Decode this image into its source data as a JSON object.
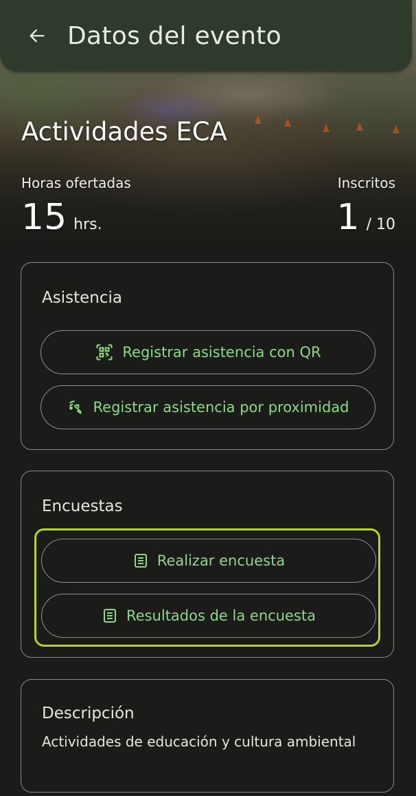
{
  "app_bar": {
    "title": "Datos del evento",
    "back_icon": "arrow-left-icon"
  },
  "event": {
    "title": "Actividades ECA",
    "hours_label": "Horas ofertadas",
    "hours_value": "15",
    "hours_unit": "hrs.",
    "enrolled_label": "Inscritos",
    "enrolled_value": "1",
    "enrolled_capacity": "/ 10"
  },
  "attendance": {
    "title": "Asistencia",
    "qr_button": "Registrar asistencia con QR",
    "qr_icon": "qr-code-scan-icon",
    "proximity_button": "Registrar asistencia por proximidad",
    "proximity_icon": "proximity-signal-icon"
  },
  "surveys": {
    "title": "Encuestas",
    "take_button": "Realizar encuesta",
    "results_button": "Resultados de la encuesta",
    "button_icon": "document-list-icon",
    "highlight_color": "#b5d629"
  },
  "description": {
    "title": "Descripción",
    "text": "Actividades de educación y cultura ambiental"
  },
  "colors": {
    "background": "#1b1c19",
    "app_bar": "#2e3a2b",
    "accent_green": "#8fd88a",
    "outline": "#8e918a"
  }
}
